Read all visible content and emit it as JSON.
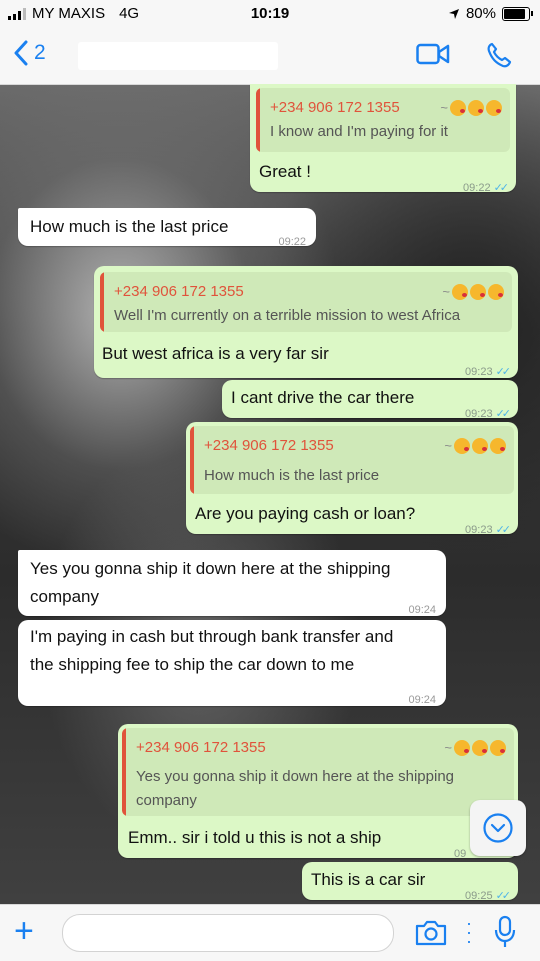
{
  "status_bar": {
    "carrier": "MY MAXIS",
    "network": "4G",
    "time": "10:19",
    "battery": "80%"
  },
  "nav": {
    "back_count": "2"
  },
  "colors": {
    "accent": "#1a80f0",
    "outgoing_bubble": "#dcf8c6",
    "incoming_bubble": "#ffffff",
    "quote_name": "#e0533b",
    "read_ticks": "#4fb4e8"
  },
  "messages": [
    {
      "direction": "out",
      "quote_name": "+234 906 172 1355",
      "quote_text": "I know and I'm paying for it",
      "text": "Great !",
      "time": "09:22"
    },
    {
      "direction": "in",
      "text": "How much is the last price",
      "time": "09:22"
    },
    {
      "direction": "out",
      "quote_name": "+234 906 172 1355",
      "quote_text": "Well I'm currently on a terrible mission to west Africa",
      "text": "But west africa is a very far sir",
      "time": "09:23"
    },
    {
      "direction": "out",
      "text": "I cant drive the car there",
      "time": "09:23"
    },
    {
      "direction": "out",
      "quote_name": "+234 906 172 1355",
      "quote_text": "How much is the last price",
      "text": "Are you paying cash or loan?",
      "time": "09:23"
    },
    {
      "direction": "in",
      "text_line1": "Yes you gonna ship it down here at the shipping",
      "text_line2": "company",
      "time": "09:24"
    },
    {
      "direction": "in",
      "text_line1": "I'm paying in cash but through bank transfer and",
      "text_line2": "the shipping fee to ship the car down to me",
      "time": "09:24"
    },
    {
      "direction": "out",
      "quote_name": "+234 906 172 1355",
      "quote_text_line1": "Yes you gonna ship it down here at the shipping",
      "quote_text_line2": "company",
      "text": "Emm.. sir i told u this is not a ship",
      "time": "09"
    },
    {
      "direction": "out",
      "text": "This is a car sir",
      "time": "09:25"
    }
  ]
}
